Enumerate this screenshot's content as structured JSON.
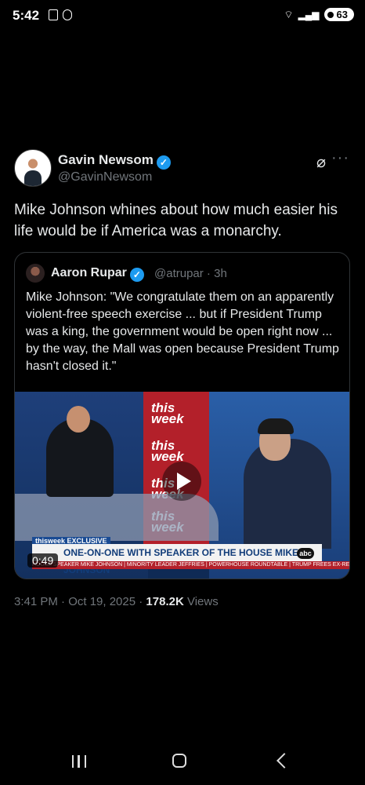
{
  "status_bar": {
    "time": "5:42",
    "battery": "63"
  },
  "tweet": {
    "author_name": "Gavin Newsom",
    "author_handle": "@GavinNewsom",
    "text": "Mike Johnson whines about how much easier his life would be if America was a monarchy.",
    "timestamp": "3:41 PM · Oct 19, 2025 · ",
    "views_count": "178.2K",
    "views_label": "Views"
  },
  "quoted_tweet": {
    "author_name": "Aaron Rupar",
    "author_handle": "@atrupar",
    "time_ago": "3h",
    "text": "Mike Johnson: \"We congratulate them on an apparently violent-free speech exercise ... but if President Trump was a king, the government would be open right now ... by the way, the Mall was open because President Trump hasn't closed it.\"",
    "video": {
      "duration": "0:49",
      "chyron": "ONE-ON-ONE WITH SPEAKER OF THE HOUSE MIKE JOHNSON",
      "exclusive_tag": "thisweek EXCLUSIVE",
      "ticker": "HOUSE SPEAKER MIKE JOHNSON | MINORITY LEADER JEFFRIES | POWERHOUSE ROUNDTABLE | TRUMP FREES EX-REP. SANTOS",
      "panel_logo": "this week",
      "bug": "abc"
    }
  },
  "icons": {
    "grok": "grok-icon",
    "more": "more-icon",
    "verified": "verified-icon"
  },
  "colors": {
    "verified": "#1d9bf0",
    "muted": "#71767b",
    "background": "#000000"
  }
}
